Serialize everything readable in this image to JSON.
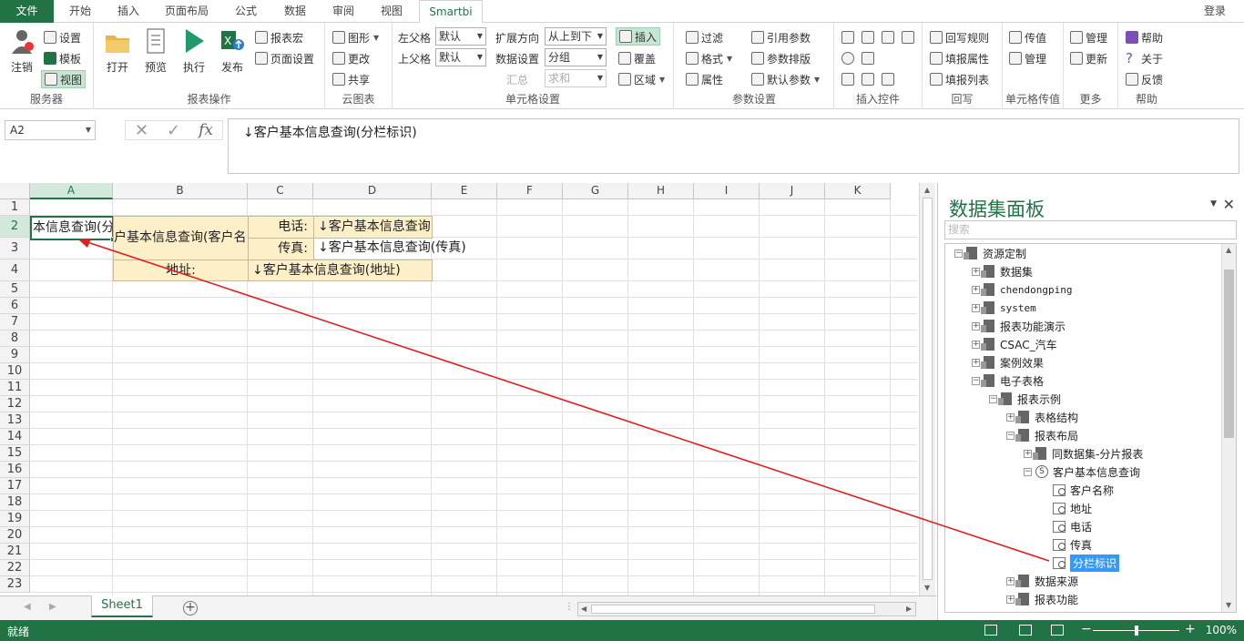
{
  "tabs": [
    "文件",
    "开始",
    "插入",
    "页面布局",
    "公式",
    "数据",
    "审阅",
    "视图",
    "Smartbi"
  ],
  "login": "登录",
  "ribbon": {
    "server": {
      "label": "服务器",
      "logout": "注销",
      "settings": "设置",
      "template": "模板",
      "view": "视图"
    },
    "report_ops": {
      "label": "报表操作",
      "open": "打开",
      "preview": "预览",
      "execute": "执行",
      "publish": "发布",
      "macro": "报表宏",
      "page_setup": "页面设置"
    },
    "cloud": {
      "label": "云图表",
      "shape": "图形",
      "change": "更改",
      "share": "共享"
    },
    "cell_settings": {
      "label": "单元格设置",
      "left_parent": "左父格",
      "left_parent_value": "默认",
      "top_parent": "上父格",
      "top_parent_value": "默认",
      "expand_dir": "扩展方向",
      "expand_dir_value": "从上到下",
      "data_setting": "数据设置",
      "data_setting_value": "分组",
      "summary": "汇总",
      "summary_value": "求和",
      "insert": "插入",
      "cover": "覆盖",
      "region": "区域"
    },
    "params": {
      "label": "参数设置",
      "filter": "过滤",
      "format": "格式",
      "attribute": "属性",
      "ref_param": "引用参数",
      "param_layout": "参数排版",
      "default_param": "默认参数"
    },
    "controls": {
      "label": "插入控件"
    },
    "writeback": {
      "label": "回写",
      "rule": "回写规则",
      "fill_attr": "填报属性",
      "fill_list": "填报列表"
    },
    "cell_pass": {
      "label": "单元格传值",
      "pass": "传值",
      "manage": "管理"
    },
    "more": {
      "label": "更多",
      "manage": "管理",
      "update": "更新"
    },
    "help": {
      "label": "帮助",
      "help": "帮助",
      "about": "关于",
      "feedback": "反馈"
    }
  },
  "formula_bar": {
    "name_box": "A2",
    "formula": "↓客户基本信息查询(分栏标识)",
    "fx": "fx"
  },
  "sheet": {
    "columns": [
      "A",
      "B",
      "C",
      "D",
      "E",
      "F",
      "G",
      "H",
      "I",
      "J",
      "K"
    ],
    "rows": [
      "1",
      "2",
      "3",
      "4",
      "5",
      "6",
      "7",
      "8",
      "9",
      "10",
      "11",
      "12",
      "13",
      "14",
      "15",
      "16",
      "17",
      "18",
      "19",
      "20",
      "21",
      "22",
      "23"
    ],
    "cells": {
      "a2": "本信息查询(分",
      "b23": "户基本信息查询(客户名",
      "c2": "电话:",
      "d2": "↓客户基本信息查询",
      "c3": "传真:",
      "d3": "↓客户基本信息查询(传真)",
      "b4": "地址:",
      "c4": "↓客户基本信息查询(地址)"
    },
    "tab": "Sheet1"
  },
  "status": {
    "ready": "就绪",
    "zoom": "100%"
  },
  "panel": {
    "title": "数据集面板",
    "search_placeholder": "搜索",
    "tree": [
      {
        "label": "资源定制"
      },
      {
        "label": "数据集"
      },
      {
        "label": "chendongping"
      },
      {
        "label": "system"
      },
      {
        "label": "报表功能演示"
      },
      {
        "label": "CSAC_汽车"
      },
      {
        "label": "案例效果"
      },
      {
        "label": "电子表格"
      },
      {
        "label": "报表示例"
      },
      {
        "label": "表格结构"
      },
      {
        "label": "报表布局"
      },
      {
        "label": "同数据集-分片报表"
      },
      {
        "label": "客户基本信息查询"
      },
      {
        "label": "客户名称"
      },
      {
        "label": "地址"
      },
      {
        "label": "电话"
      },
      {
        "label": "传真"
      },
      {
        "label": "分栏标识"
      },
      {
        "label": "数据来源"
      },
      {
        "label": "报表功能"
      }
    ]
  },
  "colors": {
    "excel_green": "#217346",
    "cell_fill": "#fdf0c9",
    "arrow": "#e02020",
    "highlight": "#3399ff"
  }
}
